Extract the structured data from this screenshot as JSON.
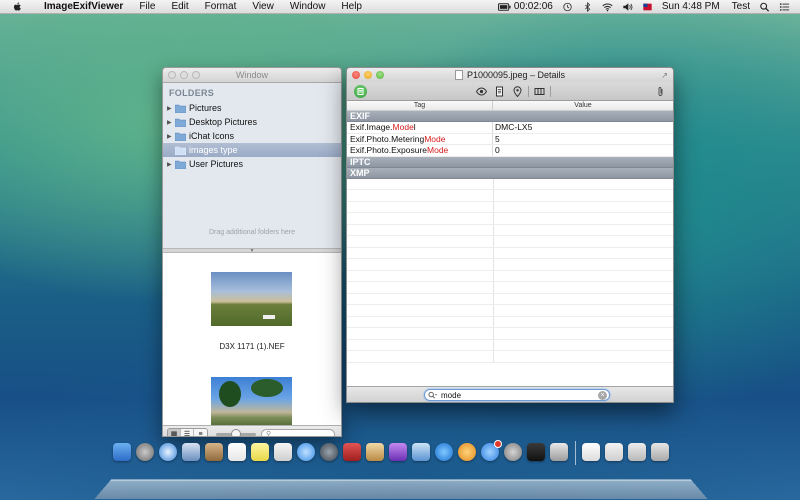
{
  "menubar": {
    "app_name": "ImageExifViewer",
    "items": [
      "File",
      "Edit",
      "Format",
      "View",
      "Window",
      "Help"
    ],
    "battery_time": "00:02:06",
    "clock": "Sun 4:48 PM",
    "user": "Test"
  },
  "browser_window": {
    "title": "Window",
    "sidebar_header": "FOLDERS",
    "folders": [
      {
        "label": "Pictures",
        "expandable": true,
        "selected": false
      },
      {
        "label": "Desktop Pictures",
        "expandable": true,
        "selected": false
      },
      {
        "label": "iChat Icons",
        "expandable": true,
        "selected": false
      },
      {
        "label": "images type",
        "expandable": false,
        "selected": true
      },
      {
        "label": "User Pictures",
        "expandable": true,
        "selected": false
      }
    ],
    "drag_hint": "Drag additional folders here",
    "thumbnails": [
      {
        "caption": "D3X 1171 (1).NEF"
      },
      {
        "caption": ""
      }
    ]
  },
  "details_window": {
    "title": "P1000095.jpeg – Details",
    "columns": {
      "tag": "Tag",
      "value": "Value"
    },
    "groups": [
      {
        "name": "EXIF",
        "rows": [
          {
            "tag_prefix": "Exif.Image.",
            "tag_match": "Mode",
            "tag_suffix": "l",
            "value": "DMC-LX5"
          },
          {
            "tag_prefix": "Exif.Photo.Metering",
            "tag_match": "Mode",
            "tag_suffix": "",
            "value": "5"
          },
          {
            "tag_prefix": "Exif.Photo.Exposure",
            "tag_match": "Mode",
            "tag_suffix": "",
            "value": "0"
          }
        ]
      },
      {
        "name": "IPTC",
        "rows": []
      },
      {
        "name": "XMP",
        "rows": []
      }
    ],
    "search": {
      "value": "mode"
    }
  },
  "colors": {
    "match_highlight": "#d81b1b",
    "selection": "#9aabc6",
    "group_header": "#8d96a2"
  }
}
